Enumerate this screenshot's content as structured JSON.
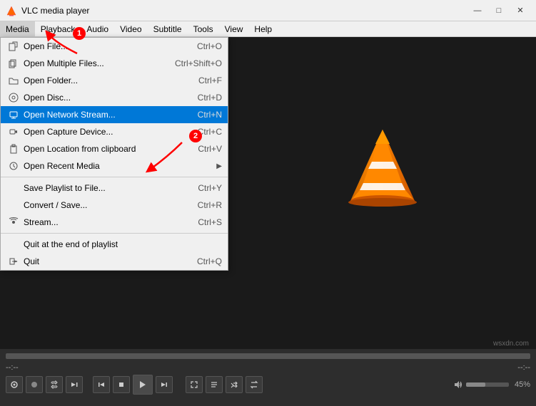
{
  "titleBar": {
    "title": "VLC media player",
    "minimize": "—",
    "maximize": "□",
    "close": "✕"
  },
  "menuBar": {
    "items": [
      {
        "label": "Media",
        "active": true
      },
      {
        "label": "Playback"
      },
      {
        "label": "Audio"
      },
      {
        "label": "Video"
      },
      {
        "label": "Subtitle"
      },
      {
        "label": "Tools"
      },
      {
        "label": "View"
      },
      {
        "label": "Help"
      }
    ]
  },
  "dropdown": {
    "items": [
      {
        "label": "Open File...",
        "shortcut": "Ctrl+O",
        "icon": "file",
        "highlighted": false
      },
      {
        "label": "Open Multiple Files...",
        "shortcut": "Ctrl+Shift+O",
        "icon": "files",
        "highlighted": false
      },
      {
        "label": "Open Folder...",
        "shortcut": "Ctrl+F",
        "icon": "folder",
        "highlighted": false
      },
      {
        "label": "Open Disc...",
        "shortcut": "Ctrl+D",
        "icon": "disc",
        "highlighted": false
      },
      {
        "label": "Open Network Stream...",
        "shortcut": "Ctrl+N",
        "icon": "network",
        "highlighted": true
      },
      {
        "label": "Open Capture Device...",
        "shortcut": "Ctrl+C",
        "icon": "capture",
        "highlighted": false
      },
      {
        "label": "Open Location from clipboard",
        "shortcut": "Ctrl+V",
        "icon": "clipboard",
        "highlighted": false
      },
      {
        "label": "Open Recent Media",
        "shortcut": "",
        "icon": "recent",
        "hasArrow": true,
        "highlighted": false,
        "separator": true
      },
      {
        "label": "Save Playlist to File...",
        "shortcut": "Ctrl+Y",
        "icon": "",
        "highlighted": false
      },
      {
        "label": "Convert / Save...",
        "shortcut": "Ctrl+R",
        "icon": "",
        "highlighted": false
      },
      {
        "label": "Stream...",
        "shortcut": "Ctrl+S",
        "icon": "stream",
        "highlighted": false,
        "separator": true
      },
      {
        "label": "Quit at the end of playlist",
        "shortcut": "",
        "icon": "",
        "highlighted": false
      },
      {
        "label": "Quit",
        "shortcut": "Ctrl+Q",
        "icon": "quit",
        "highlighted": false
      }
    ]
  },
  "annotations": {
    "badge1": "1",
    "badge2": "2"
  },
  "bottomBar": {
    "timeLeft": "--:--",
    "timeRight": "--:--",
    "volumePercent": "45%"
  }
}
